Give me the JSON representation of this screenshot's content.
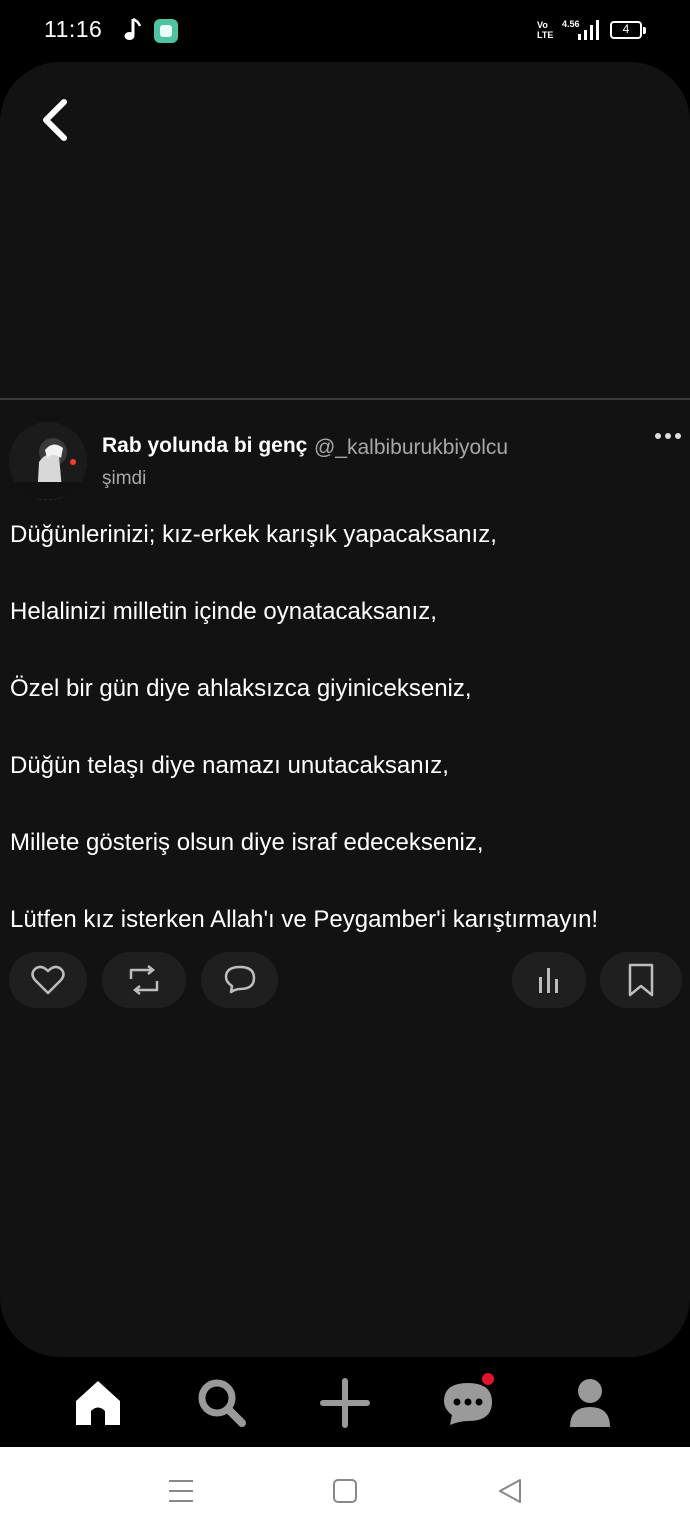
{
  "status_bar": {
    "time": "11:16",
    "network_type": "VoLTE",
    "network_speed": "4.56",
    "battery_level": "4"
  },
  "post": {
    "author_name": "Rab yolunda bi genç",
    "author_handle": "@_kalbiburukbiyolcu",
    "timestamp": "şimdi",
    "lines": [
      "Düğünlerinizi; kız-erkek karışık yapacaksanız,",
      "Helalinizi milletin içinde oynatacaksanız,",
      "Özel bir gün diye ahlaksızca giyinicekseniz,",
      "Düğün telaşı diye namazı unutacaksanız,",
      "Millete gösteriş olsun diye israf edecekseniz,",
      "Lütfen kız isterken Allah'ı ve Peygamber'i karıştırmayın!"
    ]
  },
  "actions": {
    "like_icon": "heart-icon",
    "repost_icon": "repost-icon",
    "reply_icon": "comment-icon",
    "stats_icon": "bar-chart-icon",
    "bookmark_icon": "bookmark-icon"
  },
  "bottom_nav": {
    "items": [
      "home-icon",
      "search-icon",
      "plus-icon",
      "chat-icon",
      "user-icon"
    ],
    "messages_has_notification": true
  },
  "colors": {
    "background": "#000000",
    "card": "#121212",
    "pill": "#1f1f1f",
    "muted_text": "#a8a8a8",
    "notification_dot": "#e0142c"
  }
}
